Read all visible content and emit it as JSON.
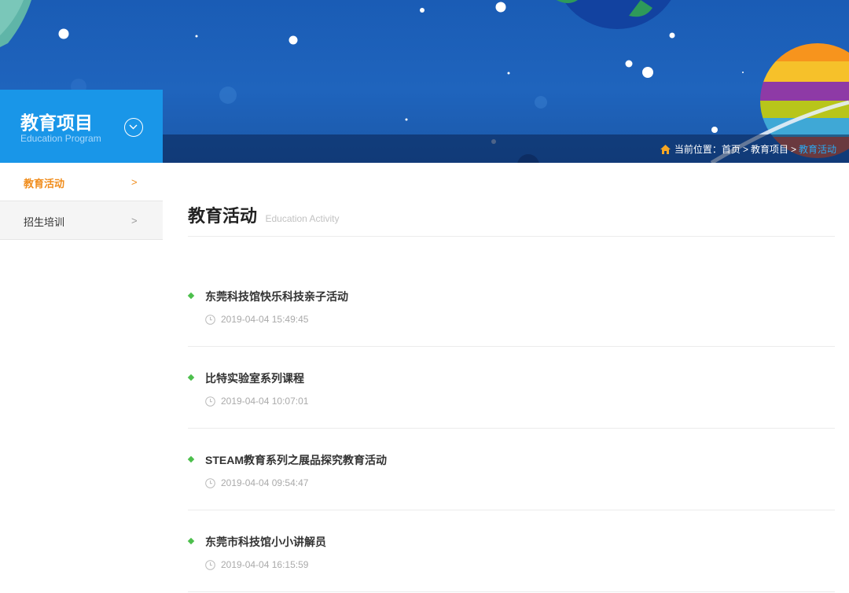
{
  "colors": {
    "accent_blue": "#1996e8",
    "active_orange": "#f08d1d",
    "bullet_green": "#4cbf4c",
    "banner_blue": "#1f64bd"
  },
  "banner": {
    "breadcrumb": {
      "icon": "home-icon",
      "prefix": "当前位置：",
      "items": [
        "首页",
        "教育项目"
      ],
      "separator": ">",
      "current": "教育活动"
    }
  },
  "sidebar": {
    "title": "教育项目",
    "subtitle": "Education Program",
    "toggle_icon": "chevron-down-circle-icon",
    "items": [
      {
        "label": "教育活动",
        "active": true
      },
      {
        "label": "招生培训",
        "active": false
      }
    ],
    "chevron": ">"
  },
  "main": {
    "title": "教育活动",
    "subtitle": "Education Activity",
    "articles": [
      {
        "title": "东莞科技馆快乐科技亲子活动",
        "date": "2019-04-04 15:49:45"
      },
      {
        "title": "比特实验室系列课程",
        "date": "2019-04-04 10:07:01"
      },
      {
        "title": "STEAM教育系列之展品探究教育活动",
        "date": "2019-04-04 09:54:47"
      },
      {
        "title": "东莞市科技馆小小讲解员",
        "date": "2019-04-04 16:15:59"
      }
    ]
  }
}
